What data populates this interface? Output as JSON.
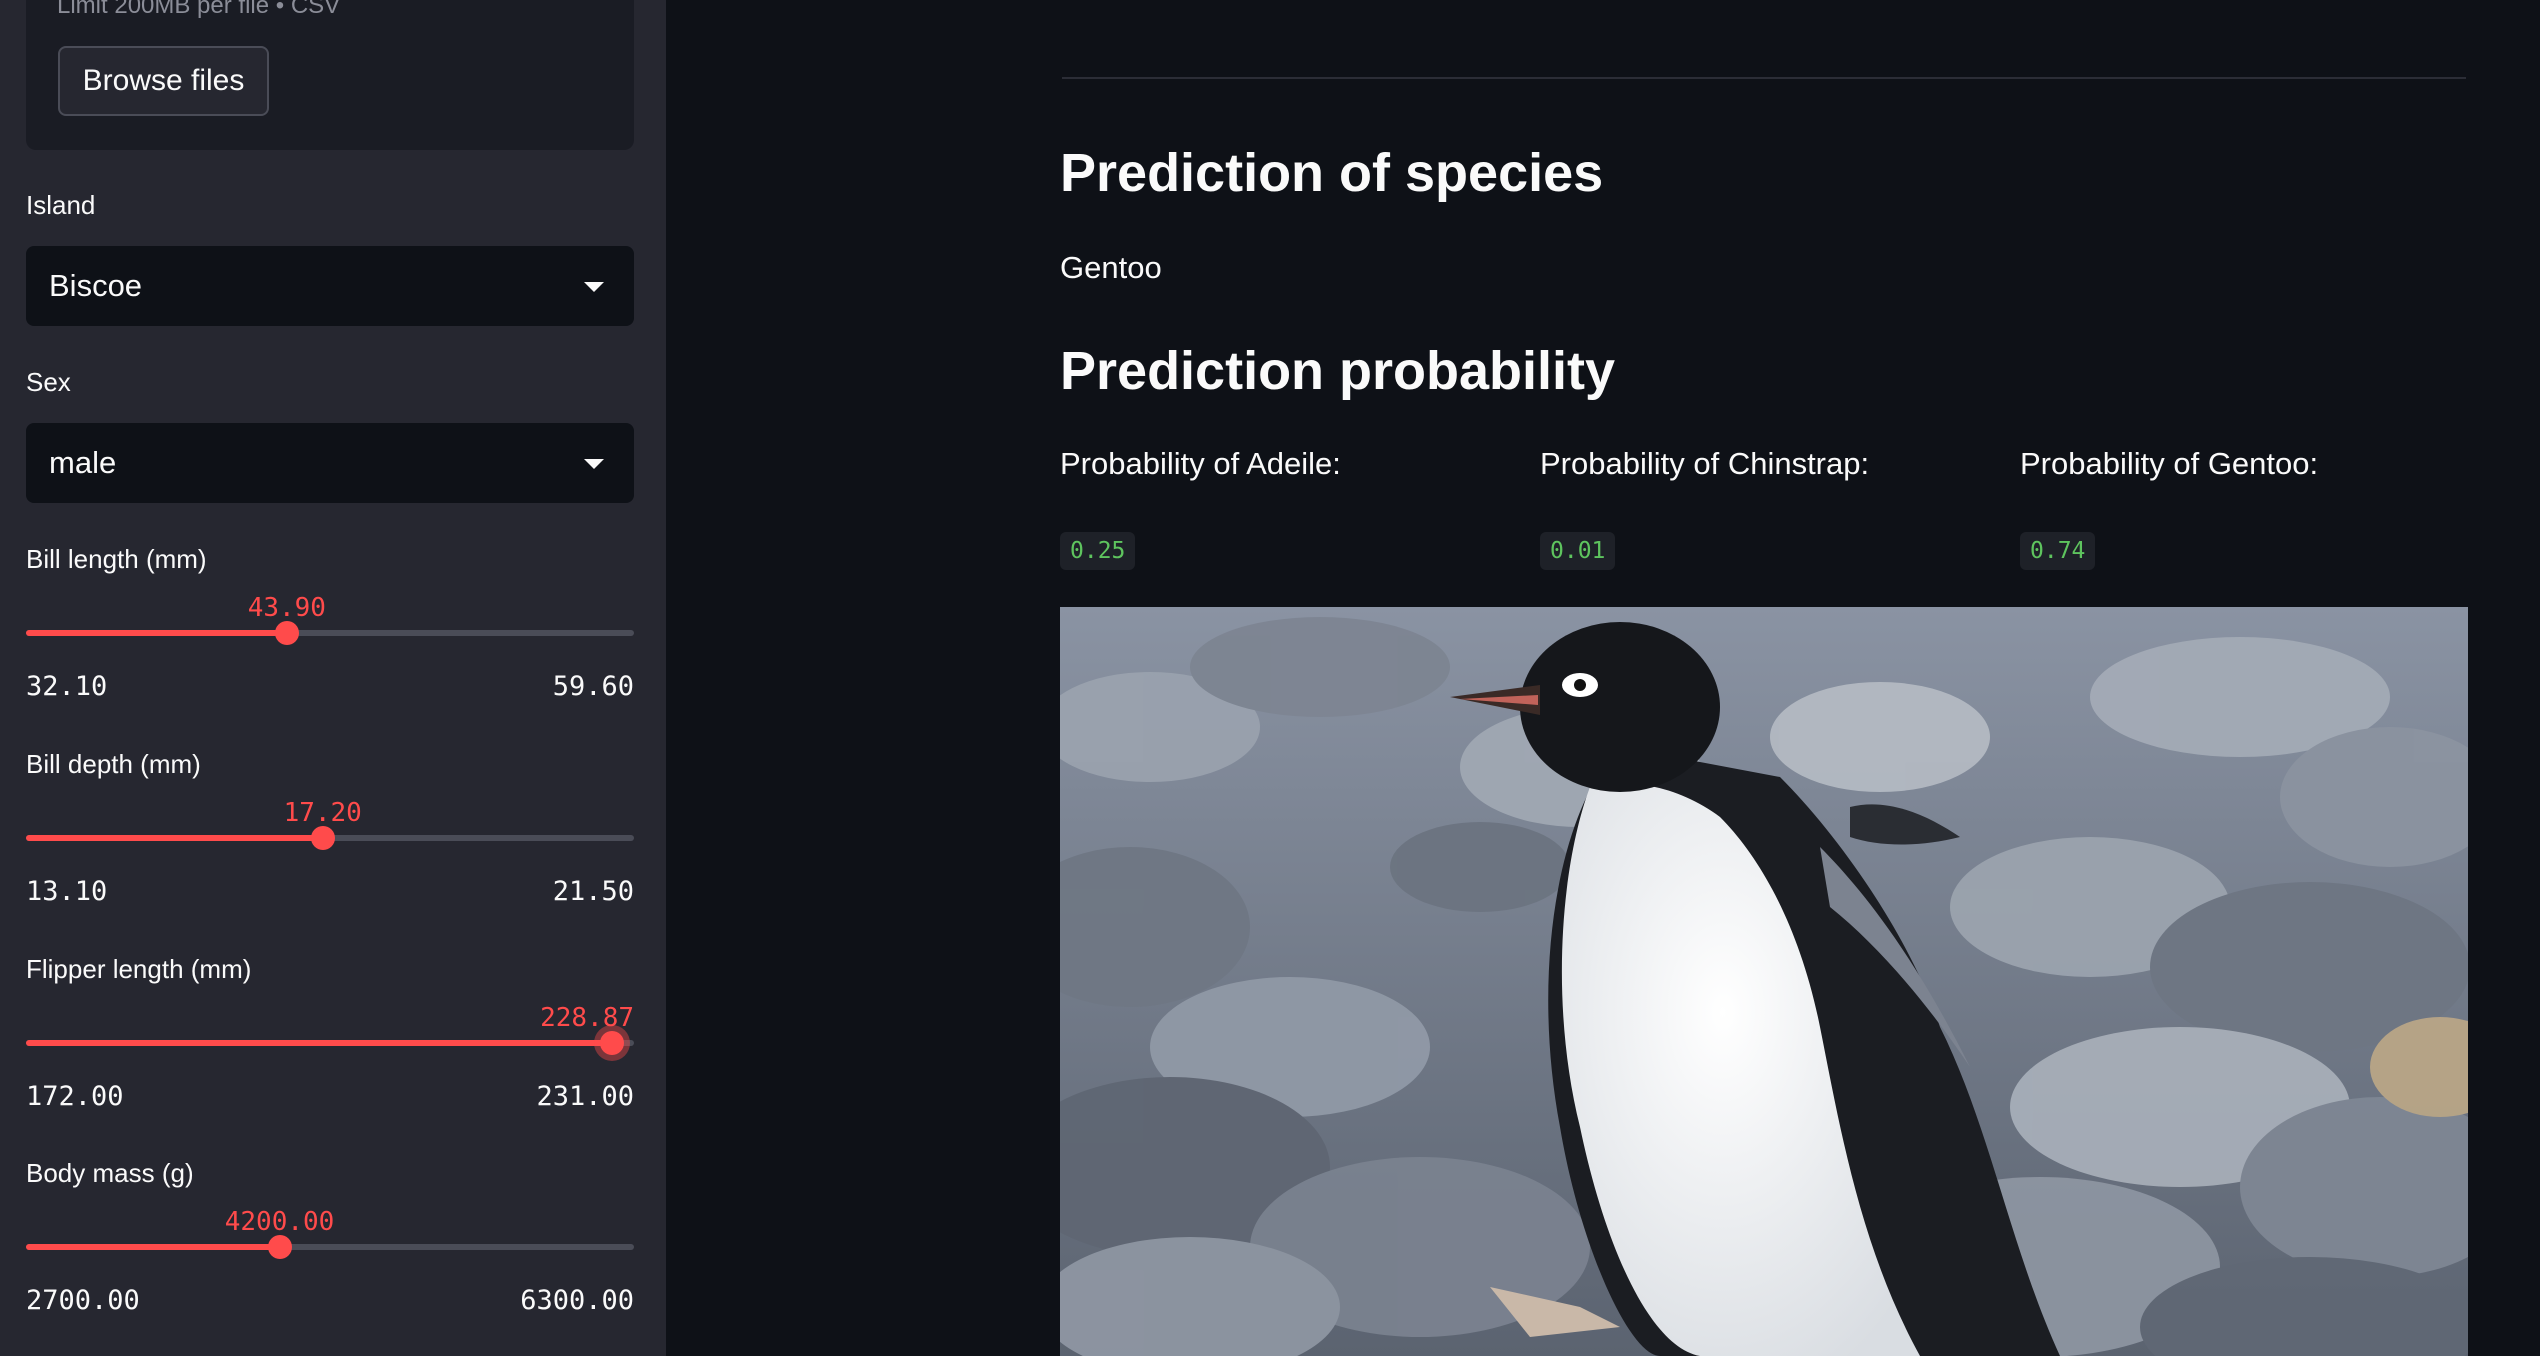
{
  "sidebar": {
    "uploader": {
      "limit_text": "Limit 200MB per file • CSV",
      "browse_label": "Browse files"
    },
    "island": {
      "label": "Island",
      "value": "Biscoe"
    },
    "sex": {
      "label": "Sex",
      "value": "male"
    },
    "sliders": [
      {
        "label": "Bill length (mm)",
        "value": "43.90",
        "min": "32.10",
        "max": "59.60",
        "fraction": 0.429
      },
      {
        "label": "Bill depth (mm)",
        "value": "17.20",
        "min": "13.10",
        "max": "21.50",
        "fraction": 0.488
      },
      {
        "label": "Flipper length (mm)",
        "value": "228.87",
        "min": "172.00",
        "max": "231.00",
        "fraction": 0.964
      },
      {
        "label": "Body mass (g)",
        "value": "4200.00",
        "min": "2700.00",
        "max": "6300.00",
        "fraction": 0.417
      }
    ]
  },
  "main": {
    "species_heading": "Prediction of species",
    "species_result": "Gentoo",
    "probability_heading": "Prediction probability",
    "probabilities": [
      {
        "label": "Probability of Adeile:",
        "value": "0.25"
      },
      {
        "label": "Probability of Chinstrap:",
        "value": "0.01"
      },
      {
        "label": "Probability of Gentoo:",
        "value": "0.74"
      }
    ]
  },
  "colors": {
    "accent": "#ff4b4b",
    "code_green": "#5ec45e",
    "sidebar_bg": "#262730",
    "main_bg": "#0e1117"
  }
}
